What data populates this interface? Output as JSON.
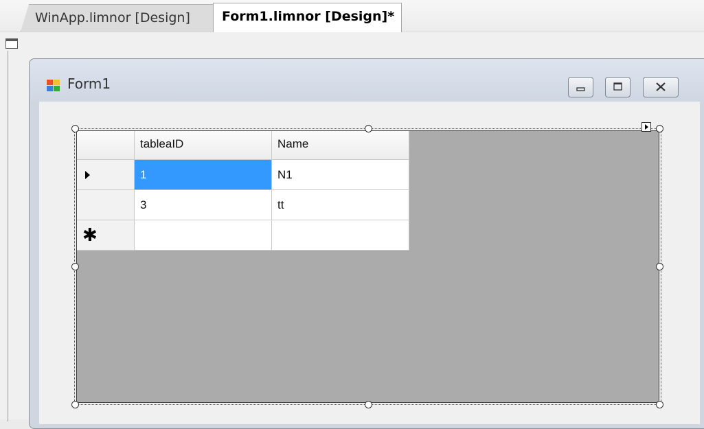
{
  "tabs": [
    {
      "label": "WinApp.limnor [Design]",
      "active": false
    },
    {
      "label": "Form1.limnor [Design]*",
      "active": true
    }
  ],
  "form": {
    "title": "Form1",
    "icon": "form-app-icon",
    "buttons": [
      "minimize-icon",
      "maximize-icon",
      "close-icon"
    ]
  },
  "grid": {
    "columns": [
      "tableaID",
      "Name"
    ],
    "rows": [
      {
        "marker": "current-row-arrow",
        "tableaID": "1",
        "Name": "N1",
        "selected_column": "tableaID"
      },
      {
        "marker": "",
        "tableaID": "3",
        "Name": "tt"
      },
      {
        "marker": "new-row-star",
        "tableaID": "",
        "Name": ""
      }
    ],
    "new_row_glyph": "✱"
  },
  "colors": {
    "selection": "#3399ff",
    "grid_background": "#ababab",
    "form_chrome": "#cfd6e0"
  }
}
